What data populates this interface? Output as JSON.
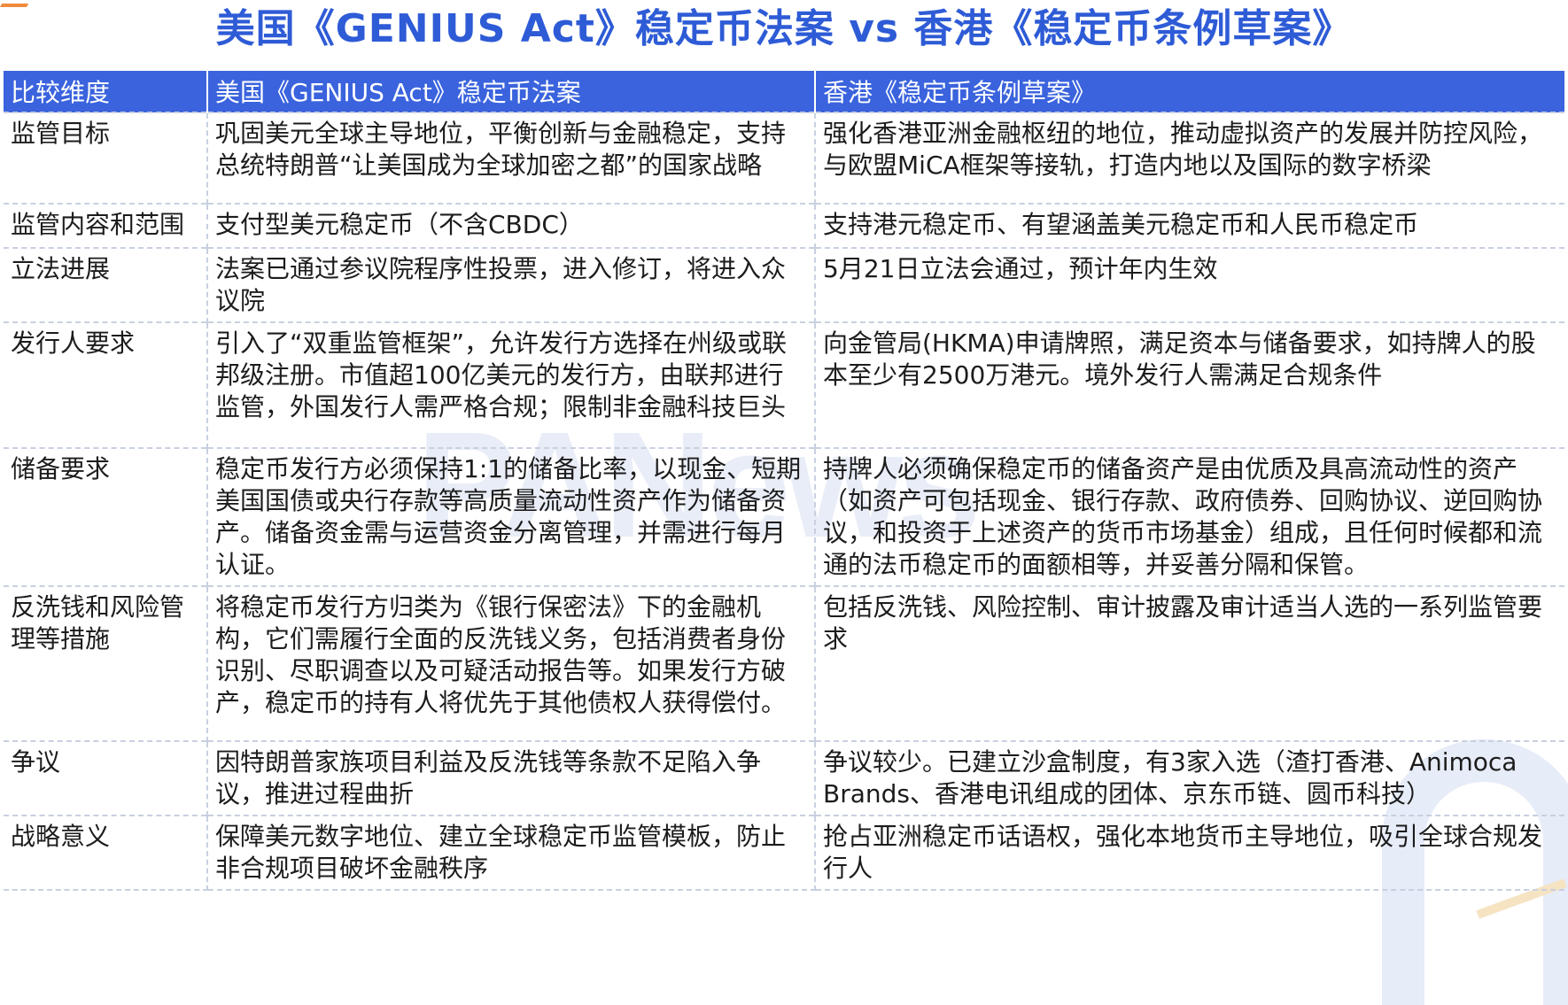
{
  "title": "美国《GENIUS Act》稳定币法案 vs 香港《稳定币条例草案》",
  "watermark": "PANews",
  "colors": {
    "title": "#2e5bd6",
    "header_bg": "#3a63dd",
    "header_text": "#ffffff"
  },
  "table": {
    "headers": [
      "比较维度",
      "美国《GENIUS Act》稳定币法案",
      "香港《稳定币条例草案》"
    ],
    "rows": [
      {
        "dimension": "监管目标",
        "us": "巩固美元全球主导地位，平衡创新与金融稳定，支持总统特朗普“让美国成为全球加密之都”的国家战略",
        "hk": "强化香港亚洲金融枢纽的地位，推动虚拟资产的发展并防控风险，与欧盟MiCA框架等接轨，打造内地以及国际的数字桥梁"
      },
      {
        "dimension": "监管内容和范围",
        "us": "支付型美元稳定币（不含CBDC）",
        "hk": "支持港元稳定币、有望涵盖美元稳定币和人民币稳定币"
      },
      {
        "dimension": "立法进展",
        "us": "法案已通过参议院程序性投票，进入修订，将进入众议院",
        "hk": "5月21日立法会通过，预计年内生效"
      },
      {
        "dimension": "发行人要求",
        "us": "引入了“双重监管框架”，允许发行方选择在州级或联邦级注册。市值超100亿美元的发行方，由联邦进行监管，外国发行人需严格合规；限制非金融科技巨头",
        "hk": "向金管局(HKMA)申请牌照，满足资本与储备要求，如持牌人的股本至少有2500万港元。境外发行人需满足合规条件"
      },
      {
        "dimension": "储备要求",
        "us": "稳定币发行方必须保持1:1的储备比率，以现金、短期美国国债或央行存款等高质量流动性资产作为储备资产。储备资金需与运营资金分离管理，并需进行每月认证。",
        "hk": "持牌人必须确保稳定币的储备资产是由优质及具高流动性的资产（如资产可包括现金、银行存款、政府债券、回购协议、逆回购协议，和投资于上述资产的货币市场基金）组成，且任何时候都和流通的法币稳定币的面额相等，并妥善分隔和保管。"
      },
      {
        "dimension": "反洗钱和风险管理等措施",
        "us": "将稳定币发行方归类为《银行保密法》下的金融机构，它们需履行全面的反洗钱义务，包括消费者身份识别、尽职调查以及可疑活动报告等。如果发行方破产，稳定币的持有人将优先于其他债权人获得偿付。",
        "hk": "包括反洗钱、风险控制、审计披露及审计适当人选的一系列监管要求"
      },
      {
        "dimension": "争议",
        "us": "因特朗普家族项目利益及反洗钱等条款不足陷入争议，推进过程曲折",
        "hk": "争议较少。已建立沙盒制度，有3家入选（渣打香港、Animoca Brands、香港电讯组成的团体、京东币链、圆币科技）"
      },
      {
        "dimension": "战略意义",
        "us": "保障美元数字地位、建立全球稳定币监管模板，防止非合规项目破坏金融秩序",
        "hk": "抢占亚洲稳定币话语权，强化本地货币主导地位，吸引全球合规发行人"
      }
    ]
  }
}
